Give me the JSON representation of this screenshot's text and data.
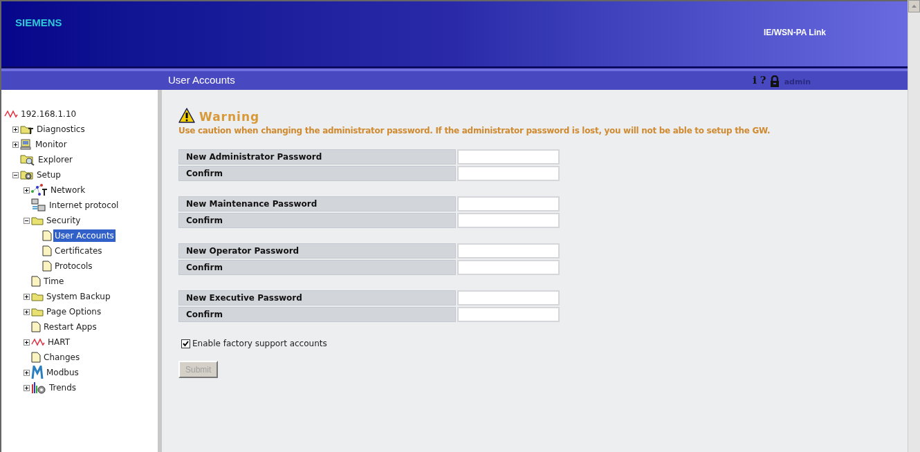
{
  "header": {
    "brand": "SIEMENS",
    "product": "IE/WSN-PA Link"
  },
  "title_bar": {
    "title": "User Accounts",
    "icons": [
      "i",
      "?"
    ],
    "user": "admin"
  },
  "tree": [
    {
      "label": "192.168.1.10",
      "kind": "wave",
      "selected": false,
      "children": [
        {
          "label": "Diagnostics",
          "kind": "tools-folder",
          "expanded": false,
          "selected": false
        },
        {
          "label": "Monitor",
          "kind": "monitor",
          "expanded": false,
          "selected": false
        },
        {
          "label": "Explorer",
          "kind": "explorer",
          "selected": false
        },
        {
          "label": "Setup",
          "kind": "gear-folder",
          "expanded": true,
          "selected": false,
          "children": [
            {
              "label": "Network",
              "kind": "network",
              "expanded": false,
              "selected": false
            },
            {
              "label": "Internet protocol",
              "kind": "computers",
              "selected": false
            },
            {
              "label": "Security",
              "kind": "folder",
              "expanded": true,
              "selected": false,
              "children": [
                {
                  "label": "User Accounts",
                  "kind": "page",
                  "selected": true
                },
                {
                  "label": "Certificates",
                  "kind": "page",
                  "selected": false
                },
                {
                  "label": "Protocols",
                  "kind": "page",
                  "selected": false
                }
              ]
            },
            {
              "label": "Time",
              "kind": "page",
              "selected": false
            },
            {
              "label": "System Backup",
              "kind": "folder",
              "expanded": false,
              "selected": false
            },
            {
              "label": "Page Options",
              "kind": "folder",
              "expanded": false,
              "selected": false
            },
            {
              "label": "Restart Apps",
              "kind": "page",
              "selected": false
            },
            {
              "label": "HART",
              "kind": "wave",
              "expanded": false,
              "selected": false
            },
            {
              "label": "Changes",
              "kind": "page",
              "selected": false
            },
            {
              "label": "Modbus",
              "kind": "modbus",
              "expanded": false,
              "selected": false
            },
            {
              "label": "Trends",
              "kind": "chart",
              "expanded": false,
              "selected": false
            }
          ]
        }
      ]
    }
  ],
  "warning": {
    "title": "Warning",
    "message": "Use caution when changing the administrator password. If the administrator password is lost, you will not be able to setup the GW."
  },
  "password_groups": [
    {
      "rows": [
        {
          "label": "New Administrator Password"
        },
        {
          "label": "Confirm"
        }
      ]
    },
    {
      "rows": [
        {
          "label": "New Maintenance Password"
        },
        {
          "label": "Confirm"
        }
      ]
    },
    {
      "rows": [
        {
          "label": "New Operator Password"
        },
        {
          "label": "Confirm"
        }
      ]
    },
    {
      "rows": [
        {
          "label": "New Executive Password"
        },
        {
          "label": "Confirm"
        }
      ]
    }
  ],
  "factory_support": {
    "label": "Enable factory support accounts",
    "checked": true
  },
  "submit": {
    "label": "Submit",
    "disabled": true
  }
}
